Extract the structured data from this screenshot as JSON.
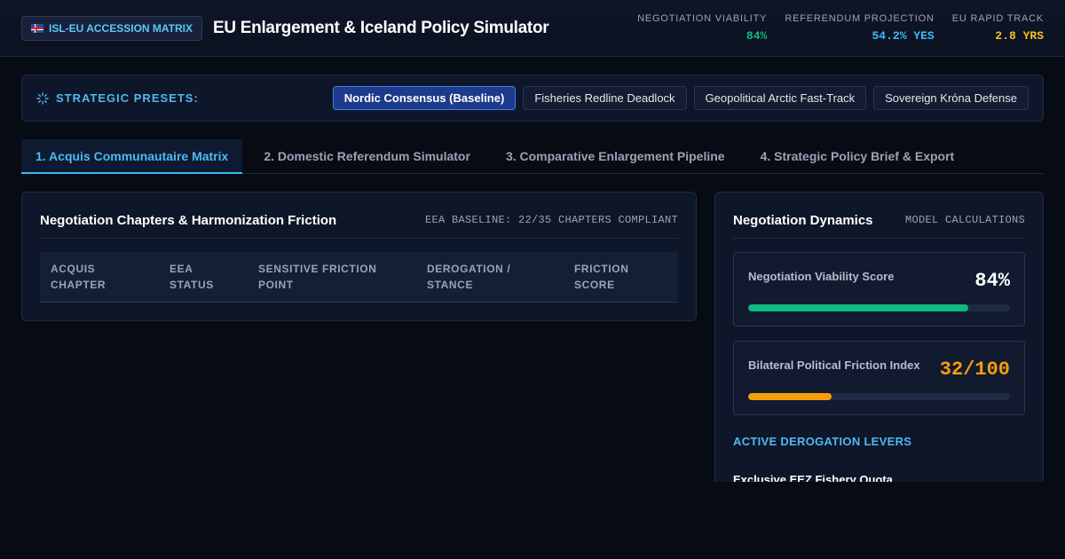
{
  "header": {
    "badge_label": "ISL-EU ACCESSION MATRIX",
    "title": "EU Enlargement & Iceland Policy Simulator",
    "stats": [
      {
        "label": "NEGOTIATION VIABILITY",
        "value": "84%",
        "color": "#10b981"
      },
      {
        "label": "REFERENDUM PROJECTION",
        "value": "54.2% YES",
        "color": "#38bdf8"
      },
      {
        "label": "EU RAPID TRACK",
        "value": "2.8 YRS",
        "color": "#fbbf24"
      }
    ]
  },
  "presets": {
    "label": "STRATEGIC PRESETS:",
    "icon": "loader-icon",
    "items": [
      {
        "label": "Nordic Consensus (Baseline)",
        "active": true
      },
      {
        "label": "Fisheries Redline Deadlock",
        "active": false
      },
      {
        "label": "Geopolitical Arctic Fast-Track",
        "active": false
      },
      {
        "label": "Sovereign Króna Defense",
        "active": false
      }
    ]
  },
  "tabs": [
    {
      "label": "1. Acquis Communautaire Matrix",
      "active": true
    },
    {
      "label": "2. Domestic Referendum Simulator",
      "active": false
    },
    {
      "label": "3. Comparative Enlargement Pipeline",
      "active": false
    },
    {
      "label": "4. Strategic Policy Brief & Export",
      "active": false
    }
  ],
  "matrix_panel": {
    "title": "Negotiation Chapters & Harmonization Friction",
    "note": "EEA BASELINE: 22/35 CHAPTERS COMPLIANT",
    "columns": [
      {
        "line1": "ACQUIS",
        "line2": "CHAPTER"
      },
      {
        "line1": "EEA",
        "line2": "STATUS"
      },
      {
        "line1": "SENSITIVE FRICTION",
        "line2": "POINT"
      },
      {
        "line1": "DEROGATION /",
        "line2": "STANCE"
      },
      {
        "line1": "FRICTION",
        "line2": "SCORE"
      }
    ]
  },
  "dynamics_panel": {
    "title": "Negotiation Dynamics",
    "note": "MODEL CALCULATIONS",
    "metrics": [
      {
        "label": "Negotiation Viability Score",
        "value": "84%",
        "fraction": 0.84,
        "color": "#10b981",
        "value_color": "#ffffff"
      },
      {
        "label": "Bilateral Political Friction Index",
        "value": "32/100",
        "fraction": 0.32,
        "color": "#f59e0b",
        "value_color": "#f59e0b"
      }
    ],
    "levers_title": "ACTIVE DEROGATION LEVERS",
    "first_lever": "Exclusive EEZ Fishery Quota"
  }
}
